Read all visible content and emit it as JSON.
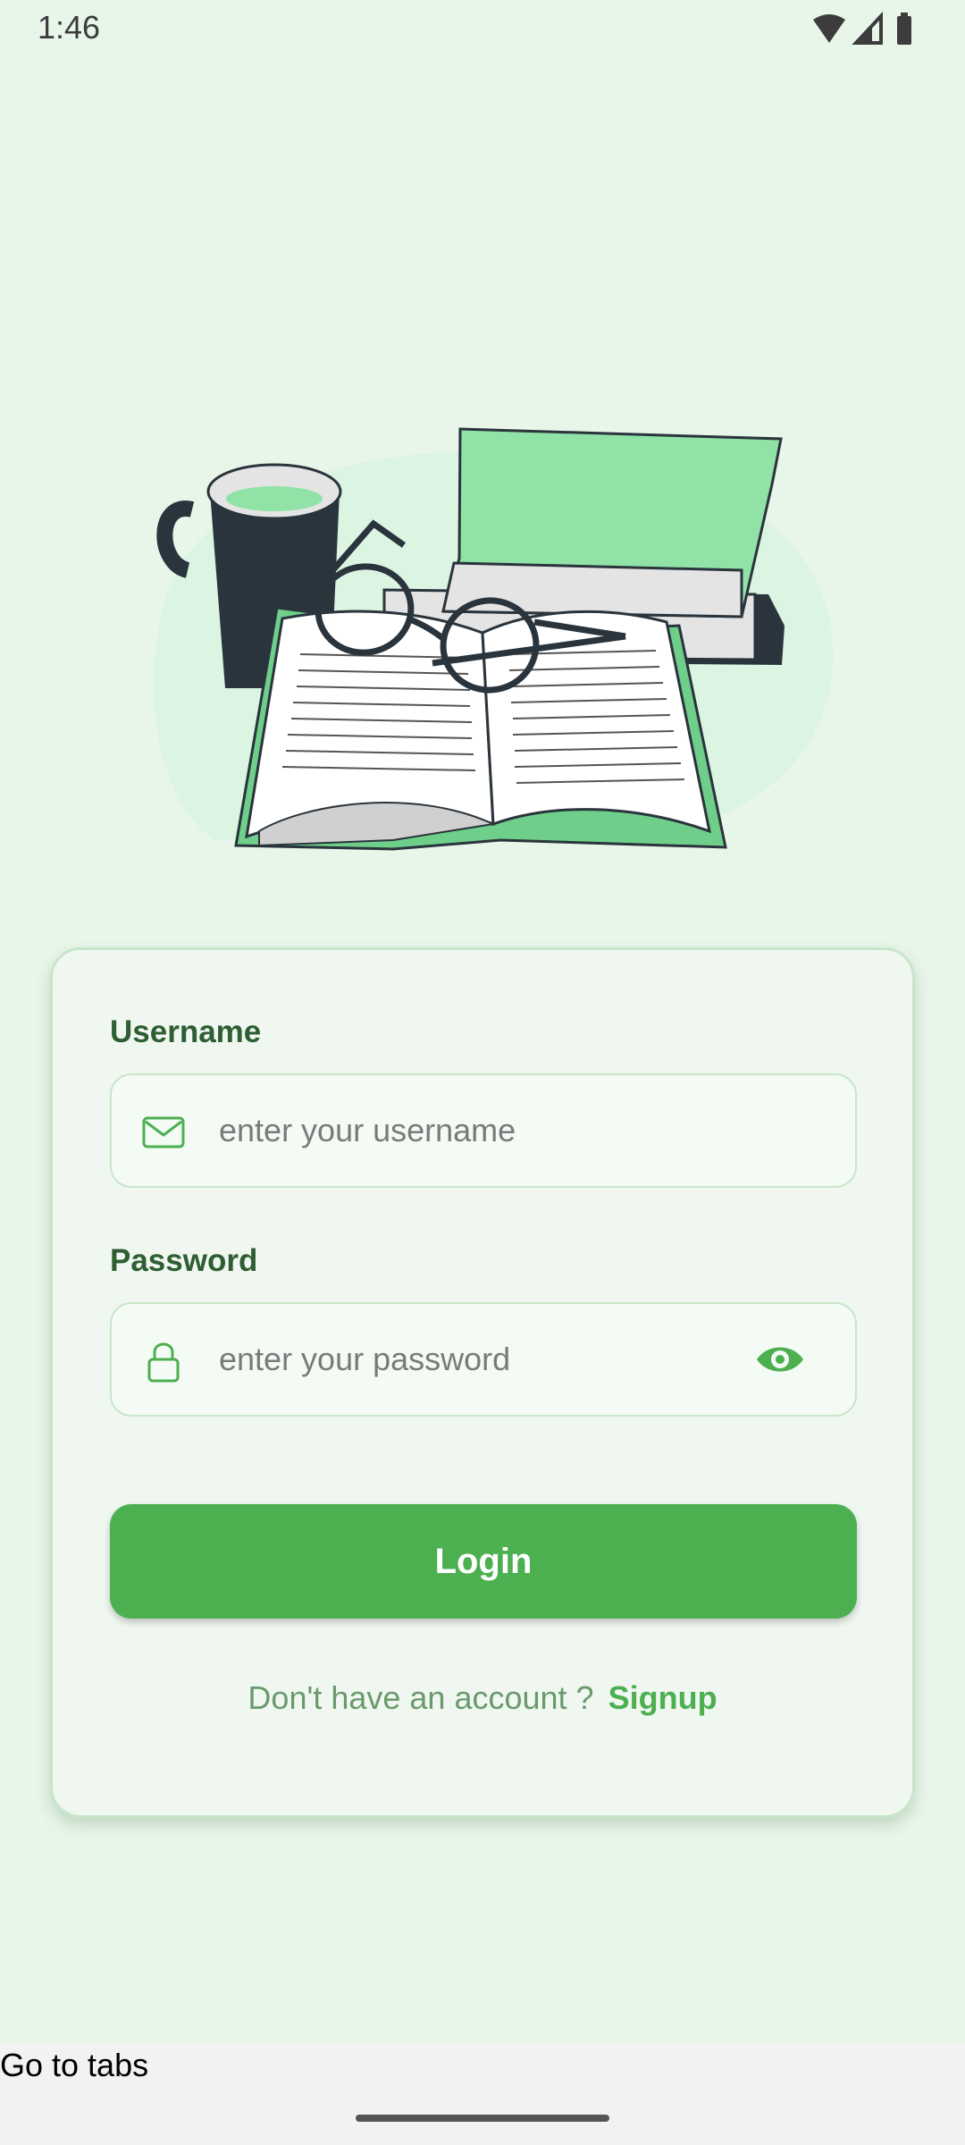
{
  "status_bar": {
    "time": "1:46"
  },
  "login_form": {
    "username": {
      "label": "Username",
      "placeholder": "enter your username"
    },
    "password": {
      "label": "Password",
      "placeholder": "enter your password"
    },
    "login_button_label": "Login",
    "signup_prompt": "Don't have an account ?",
    "signup_link_label": "Signup"
  },
  "footer": {
    "tabs_link_label": "Go to tabs"
  },
  "colors": {
    "background": "#e8f5e9",
    "card": "#f0f7f1",
    "accent": "#4caf50",
    "label": "#2e5e32",
    "book": "#90e2a6"
  },
  "icons": {
    "username_field": "mail-icon",
    "password_field": "lock-icon",
    "password_toggle": "eye-icon"
  }
}
